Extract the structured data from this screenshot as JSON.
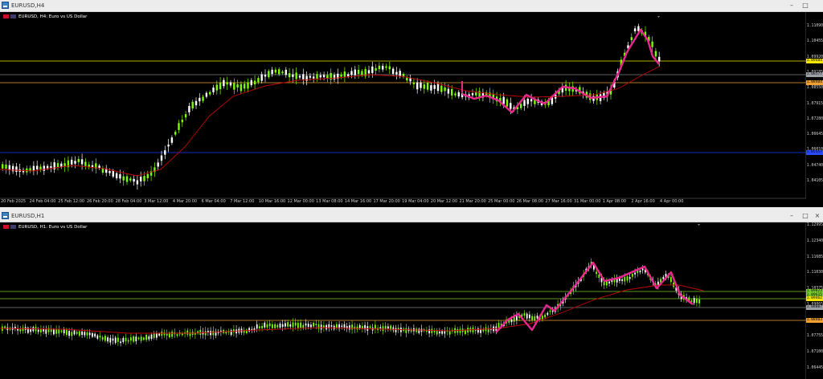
{
  "windows": {
    "top": {
      "title": "EURUSD,H4",
      "info": "EURUSD, H4: Euro vs US Dollar",
      "min_glyph": "–",
      "max_glyph": "□",
      "close_glyph": "×",
      "price_labels": [
        "1.11090",
        "1.10455",
        "1.09920",
        "1.09185",
        "1.08550",
        "1.07915",
        "1.07280",
        "1.06645",
        "1.06010",
        "1.04740",
        "1.04105"
      ],
      "price_tags": [
        {
          "text": "1.09484",
          "color": "#f2e400"
        },
        {
          "text": "1.08577",
          "color": "#9aa0a6"
        },
        {
          "text": "1.08404",
          "color": "#f0a030"
        },
        {
          "text": "1.05557",
          "color": "#2a4bff"
        }
      ],
      "time_labels": [
        "20 Feb 2025",
        "24 Feb 04:00",
        "25 Feb 12:00",
        "26 Feb 20:00",
        "28 Feb 04:00",
        "3 Mar 12:00",
        "4 Mar 20:00",
        "6 Mar 04:00",
        "7 Mar 12:00",
        "10 Mar 16:00",
        "12 Mar 00:00",
        "13 Mar 08:00",
        "14 Mar 16:00",
        "17 Mar 20:00",
        "19 Mar 04:00",
        "20 Mar 12:00",
        "21 Mar 20:00",
        "25 Mar 00:00",
        "26 Mar 08:00",
        "27 Mar 16:00",
        "31 Mar 00:00",
        "1 Apr 08:00",
        "2 Apr 16:00",
        "4 Apr 00:00"
      ]
    },
    "bottom": {
      "title": "EURUSD,H1",
      "info": "EURUSD, H1: Euro vs US Dollar",
      "min_glyph": "–",
      "max_glyph": "□",
      "close_glyph": "×",
      "price_labels": [
        "1.12995",
        "1.12340",
        "1.11685",
        "1.11030",
        "1.10375",
        "1.09065",
        "1.08410",
        "1.07755",
        "1.07100",
        "1.06445"
      ],
      "price_tags": [
        {
          "text": "1.09823",
          "color": "#7ccc30"
        },
        {
          "text": "1.09615",
          "color": "#7ccc30"
        },
        {
          "text": "1.09462",
          "color": "#f2e400"
        },
        {
          "text": "1.08807",
          "color": "#9aa0a6"
        },
        {
          "text": "1.08403",
          "color": "#f0a030"
        }
      ]
    }
  },
  "colors": {
    "bg": "#000000",
    "candle_up": "#7CFC00",
    "candle_down": "#ffffff",
    "ma_line": "#c00000",
    "zigzag": "#e8278e",
    "level_yellow": "#f2e400",
    "level_orange": "#f0a030",
    "level_gray": "#7a7f86",
    "level_blue": "#1f3bff",
    "level_green": "#7ccc30"
  }
}
